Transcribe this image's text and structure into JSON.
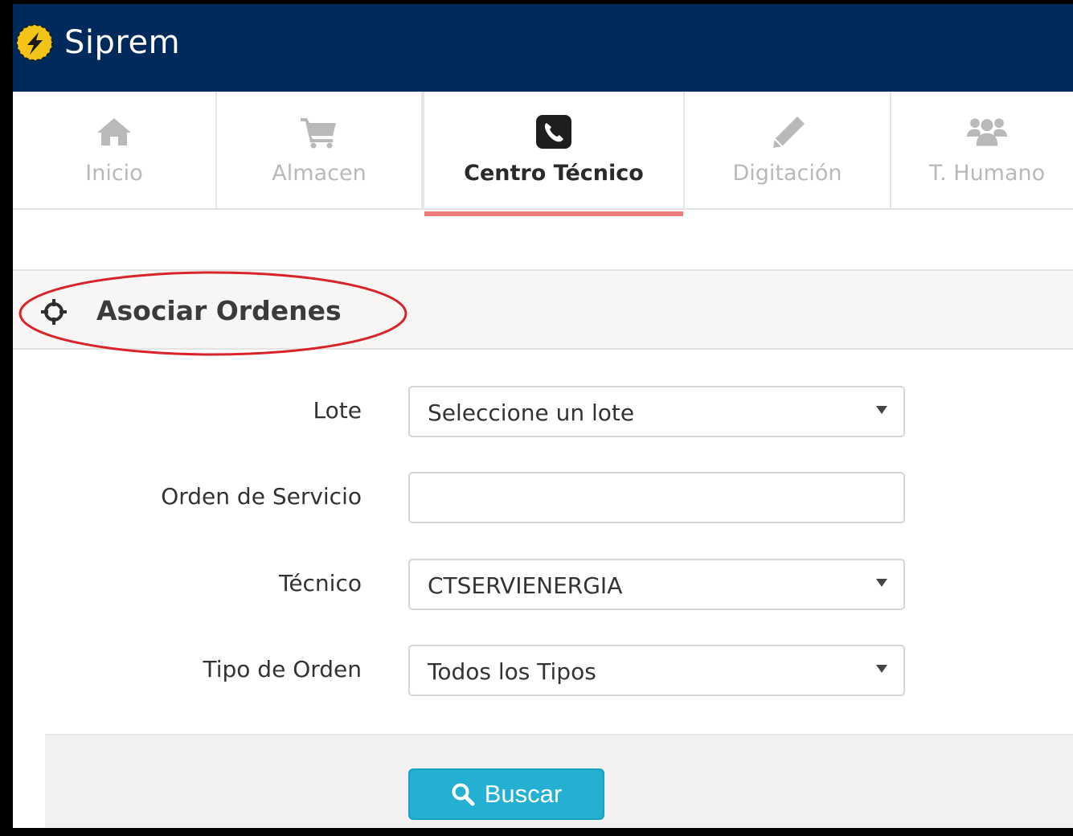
{
  "app": {
    "title": "Siprem"
  },
  "nav": {
    "tabs": [
      {
        "label": "Inicio",
        "icon": "home-icon",
        "active": false
      },
      {
        "label": "Almacen",
        "icon": "cart-icon",
        "active": false
      },
      {
        "label": "Centro Técnico",
        "icon": "phone-icon",
        "active": true
      },
      {
        "label": "Digitación",
        "icon": "pencil-icon",
        "active": false
      },
      {
        "label": "T. Humano",
        "icon": "users-icon",
        "active": false
      }
    ],
    "active_underline_color": "#f07a7a"
  },
  "section": {
    "title": "Asociar Ordenes",
    "icon": "crosshairs-icon"
  },
  "annotation": {
    "shape": "ellipse",
    "color": "#d9232a"
  },
  "form": {
    "lote": {
      "label": "Lote",
      "value": "Seleccione un lote"
    },
    "orden": {
      "label": "Orden de Servicio",
      "value": ""
    },
    "tecnico": {
      "label": "Técnico",
      "value": "CTSERVIENERGIA"
    },
    "tipo": {
      "label": "Tipo de Orden",
      "value": "Todos los Tipos"
    }
  },
  "actions": {
    "search_label": "Buscar",
    "search_icon": "search-icon",
    "search_color": "#23b0d2"
  },
  "colors": {
    "header_bg": "#002a5c",
    "text": "#333333",
    "muted_tab": "#b9b9b9"
  }
}
